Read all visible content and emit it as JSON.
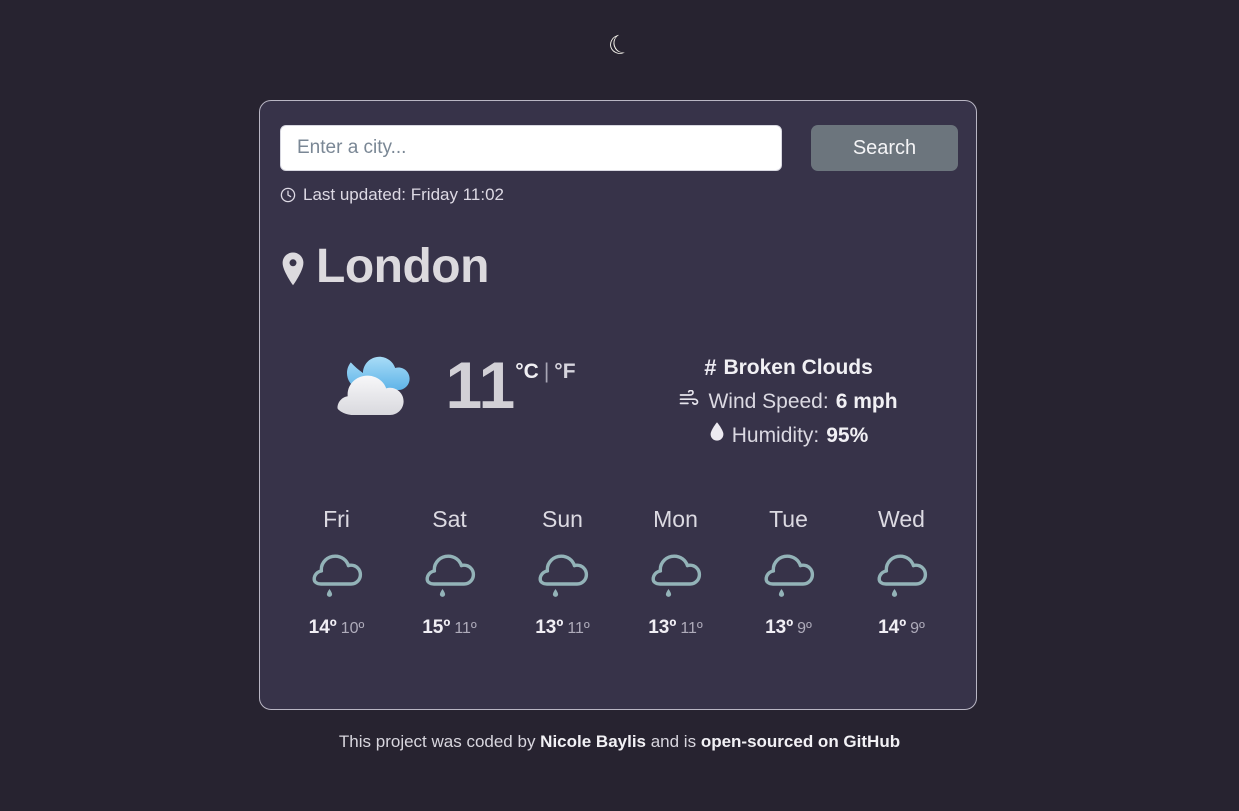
{
  "theme_toggle": {
    "icon": "crescent-moon-icon",
    "glyph": "☾"
  },
  "search": {
    "placeholder": "Enter a city...",
    "value": "",
    "button_label": "Search"
  },
  "status": {
    "icon": "clock-icon",
    "last_updated": "Last updated: Friday 11:02"
  },
  "location": {
    "icon": "map-pin-icon",
    "city": "London"
  },
  "current": {
    "icon": "broken-clouds-icon",
    "temperature": "11",
    "unit_celsius": "°C",
    "unit_separator": "|",
    "unit_fahrenheit": "°F",
    "active_unit": "°C",
    "description_icon": "hash-icon",
    "description": "Broken Clouds",
    "wind_icon": "wind-icon",
    "wind_label": "Wind Speed:",
    "wind_value": "6 mph",
    "humidity_icon": "droplet-icon",
    "humidity_label": "Humidity:",
    "humidity_value": "95%"
  },
  "forecast": [
    {
      "day": "Fri",
      "icon": "rain-cloud-icon",
      "max": "14º",
      "min": "10º"
    },
    {
      "day": "Sat",
      "icon": "rain-cloud-icon",
      "max": "15º",
      "min": "11º"
    },
    {
      "day": "Sun",
      "icon": "rain-cloud-icon",
      "max": "13º",
      "min": "11º"
    },
    {
      "day": "Mon",
      "icon": "rain-cloud-icon",
      "max": "13º",
      "min": "11º"
    },
    {
      "day": "Tue",
      "icon": "rain-cloud-icon",
      "max": "13º",
      "min": "9º"
    },
    {
      "day": "Wed",
      "icon": "rain-cloud-icon",
      "max": "14º",
      "min": "9º"
    }
  ],
  "footer": {
    "prefix": "This project was coded by ",
    "author": "Nicole Baylis",
    "middle": " and is ",
    "link": "open-sourced on GitHub"
  },
  "colors": {
    "page_background": "#272330",
    "card_background": "#373349",
    "card_border": "#b9b6c4",
    "search_button": "#6c757d",
    "text_primary": "#e3e1e6",
    "forecast_icon": "#93b3b8",
    "cloud_blue": "#7ec3ef"
  }
}
